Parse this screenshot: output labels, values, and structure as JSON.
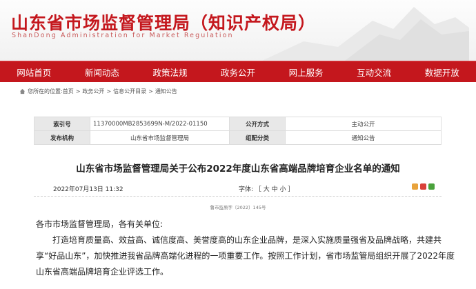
{
  "header": {
    "title": "山东省市场监督管理局（知识产权局）",
    "subtitle": "ShanDong Administration for Market Regulation"
  },
  "nav": {
    "items": [
      "网站首页",
      "新闻动态",
      "政策法规",
      "政务公开",
      "网上服务",
      "互动交流",
      "数据开放"
    ]
  },
  "breadcrumb": {
    "prefix": "您所在的位置:",
    "items": [
      "首页",
      "政务公开",
      "信息公开目录",
      "通知公告"
    ],
    "separator": ">"
  },
  "meta": {
    "index_label": "索引号",
    "index_value": "11370000MB2853699N-M/2022-01150",
    "open_label": "公开方式",
    "open_value": "主动公开",
    "org_label": "发布机构",
    "org_value": "山东省市场监督管理局",
    "cat_label": "组配分类",
    "cat_value": "通知公告"
  },
  "article": {
    "title": "山东省市场监督管理局关于公布2022年度山东省高端品牌培育企业名单的通知",
    "date": "2022年07月13日 11:32",
    "font_label": "字体: ［ 大 中 小 ］",
    "doc_number": "鲁市监质字〔2022〕145号",
    "salutation": "各市市场监督管理局，各有关单位:",
    "para1": "打造培育质量高、效益高、诚信度高、美誉度高的山东企业品牌，是深入实施质量强省及品牌战略，共建共享“好品山东”，加快推进我省品牌高端化进程的一项重要工作。按照工作计划，省市场监管局组织开展了2022年度山东省高端品牌培育企业评选工作。"
  },
  "colors": {
    "brand_red": "#c4171d"
  }
}
